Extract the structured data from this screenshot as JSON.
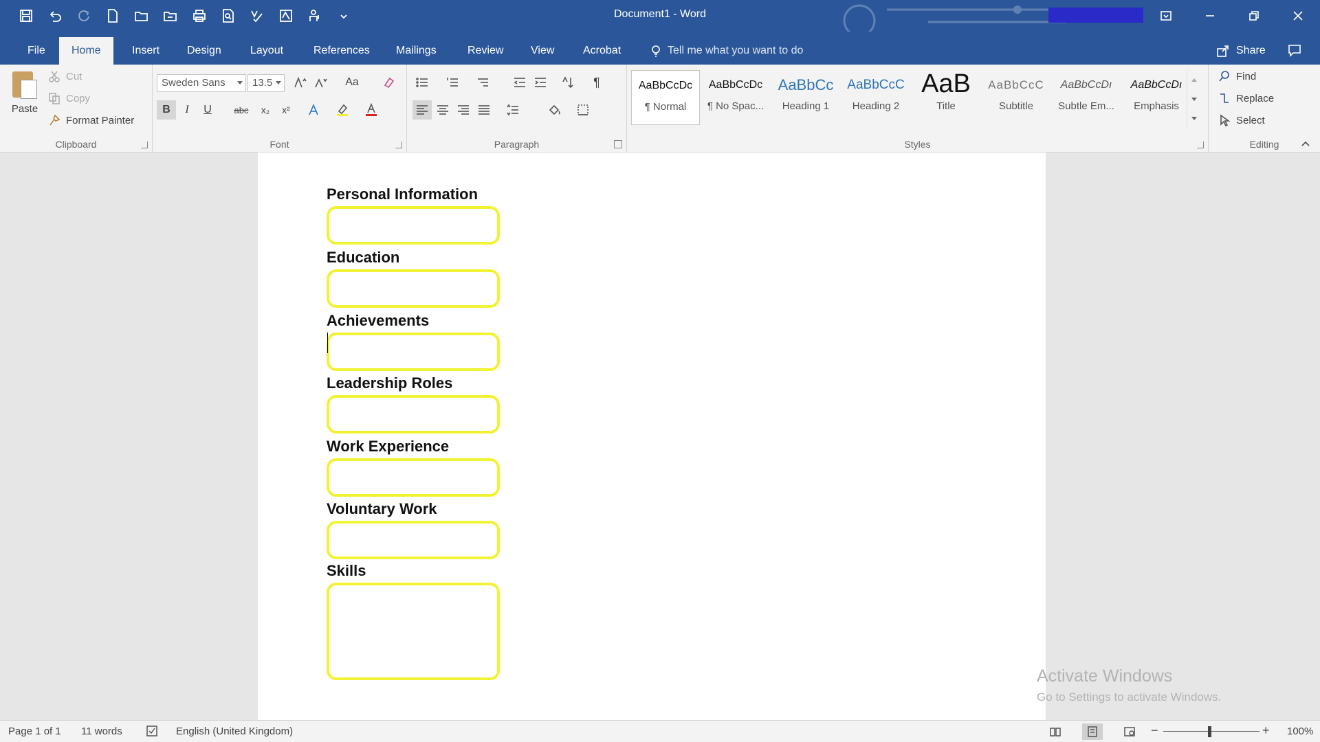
{
  "window": {
    "title": "Document1  -  Word"
  },
  "tabs": [
    "File",
    "Home",
    "Insert",
    "Design",
    "Layout",
    "References",
    "Mailings",
    "Review",
    "View",
    "Acrobat"
  ],
  "active_tab": "Home",
  "tell_me": "Tell me what you want to do",
  "share_label": "Share",
  "clipboard": {
    "paste": "Paste",
    "cut": "Cut",
    "copy": "Copy",
    "format_painter": "Format Painter",
    "group_label": "Clipboard"
  },
  "font": {
    "name": "Sweden Sans",
    "size": "13.5",
    "group_label": "Font",
    "change_case": "Aa",
    "strike": "abc"
  },
  "paragraph": {
    "group_label": "Paragraph"
  },
  "styles": {
    "group_label": "Styles",
    "items": [
      {
        "sample": "AaBbCcDc",
        "name": "¶ Normal"
      },
      {
        "sample": "AaBbCcDc",
        "name": "¶ No Spac..."
      },
      {
        "sample": "AaBbCc",
        "name": "Heading 1"
      },
      {
        "sample": "AaBbCcC",
        "name": "Heading 2"
      },
      {
        "sample": "AaB",
        "name": "Title"
      },
      {
        "sample": "AaBbCcC",
        "name": "Subtitle"
      },
      {
        "sample": "AaBbCcDı",
        "name": "Subtle Em..."
      },
      {
        "sample": "AaBbCcDı",
        "name": "Emphasis"
      }
    ]
  },
  "editing": {
    "find": "Find",
    "replace": "Replace",
    "select": "Select",
    "group_label": "Editing"
  },
  "document": {
    "sections": [
      {
        "heading": "Personal Information"
      },
      {
        "heading": "Education"
      },
      {
        "heading": "Achievements"
      },
      {
        "heading": "Leadership Roles"
      },
      {
        "heading": "Work Experience"
      },
      {
        "heading": "Voluntary Work"
      },
      {
        "heading": "Skills"
      }
    ],
    "box_color": "#f2f234"
  },
  "watermark": {
    "line1": "Activate Windows",
    "line2": "Go to Settings to activate Windows."
  },
  "status": {
    "page": "Page 1 of 1",
    "words": "11 words",
    "language": "English (United Kingdom)",
    "zoom": "100%",
    "zoom_level": 1.0
  },
  "colors": {
    "accent": "#2b579a",
    "ribbon": "#f3f3f3",
    "workspace": "#e6e6e6"
  },
  "icons": {
    "quick_access": [
      "save-icon",
      "undo-icon",
      "redo-icon",
      "new-icon",
      "open-icon",
      "folder-icon",
      "print-icon",
      "print-preview-icon",
      "spelling-icon",
      "track-icon",
      "accessibility-icon",
      "customize-icon"
    ]
  }
}
